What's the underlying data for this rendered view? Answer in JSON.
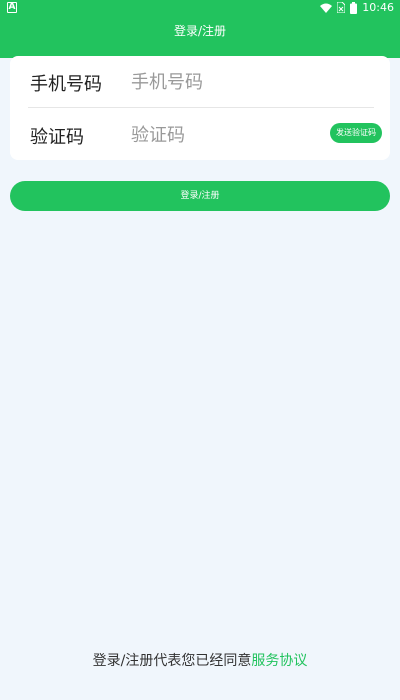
{
  "status_bar": {
    "left_icon": "A",
    "time": "10:46",
    "icons": [
      "wifi-icon",
      "sim-icon",
      "battery-icon"
    ]
  },
  "header": {
    "title": "登录/注册"
  },
  "form": {
    "phone": {
      "label": "手机号码",
      "placeholder": "手机号码"
    },
    "code": {
      "label": "验证码",
      "placeholder": "验证码",
      "send_label": "发送验证码"
    }
  },
  "submit_label": "登录/注册",
  "agreement": {
    "text": "登录/注册代表您已经同意",
    "link": "服务协议"
  },
  "colors": {
    "accent": "#22c35e",
    "background": "#f0f6fc"
  }
}
